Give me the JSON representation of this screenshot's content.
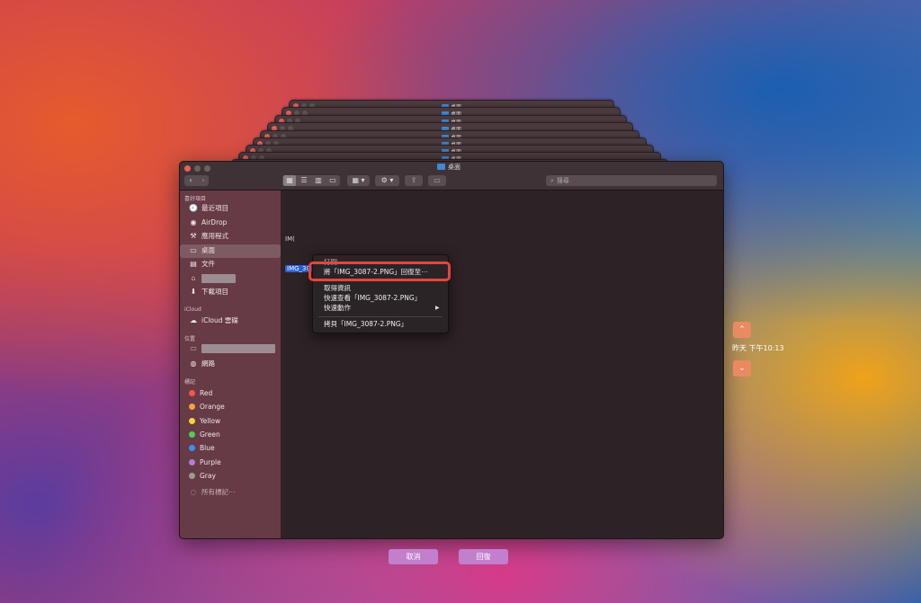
{
  "window": {
    "folder_title": "桌面",
    "stack_folder_title": "桌面",
    "search_placeholder": "搜尋"
  },
  "sidebar": {
    "favorites_header": "喜好項目",
    "favorites": [
      {
        "icon": "clock-icon",
        "glyph": "🕘",
        "label": "最近項目"
      },
      {
        "icon": "airdrop-icon",
        "glyph": "◉",
        "label": "AirDrop"
      },
      {
        "icon": "applications-icon",
        "glyph": "⚒",
        "label": "應用程式"
      },
      {
        "icon": "desktop-icon",
        "glyph": "▭",
        "label": "桌面"
      },
      {
        "icon": "document-icon",
        "glyph": "▤",
        "label": "文件"
      },
      {
        "icon": "home-icon",
        "glyph": "⌂",
        "label": ""
      },
      {
        "icon": "downloads-icon",
        "glyph": "⬇",
        "label": "下載項目"
      }
    ],
    "icloud_header": "iCloud",
    "icloud_items": [
      {
        "icon": "cloud-icon",
        "glyph": "☁",
        "label": "iCloud 雲碟"
      }
    ],
    "locations_header": "位置",
    "locations": [
      {
        "icon": "computer-icon",
        "glyph": "▭",
        "label": ""
      },
      {
        "icon": "network-icon",
        "glyph": "◍",
        "label": "網路"
      }
    ],
    "tags_header": "標記",
    "tags": [
      {
        "label": "Red",
        "color": "#f2574b"
      },
      {
        "label": "Orange",
        "color": "#f7a13b"
      },
      {
        "label": "Yellow",
        "color": "#f5d33a"
      },
      {
        "label": "Green",
        "color": "#4fcf57"
      },
      {
        "label": "Blue",
        "color": "#3d8ef0"
      },
      {
        "label": "Purple",
        "color": "#b87ad9"
      },
      {
        "label": "Gray",
        "color": "#9a9a9a"
      }
    ],
    "all_tags": "所有標記⋯"
  },
  "content": {
    "file_1": "IM(",
    "file_2": "IMG_30"
  },
  "context_menu": {
    "item_open": "打開",
    "item_restore": "將「IMG_3087-2.PNG」回復至⋯",
    "item_get_info": "取得資訊",
    "item_quicklook": "快速查看「IMG_3087-2.PNG」",
    "item_quick_actions": "快速動作",
    "item_copy": "拷貝「IMG_3087-2.PNG」"
  },
  "timemachine": {
    "up": "⌃",
    "down": "⌄",
    "time_label": "昨天 下午10:13"
  },
  "buttons": {
    "cancel": "取消",
    "restore": "回復"
  }
}
